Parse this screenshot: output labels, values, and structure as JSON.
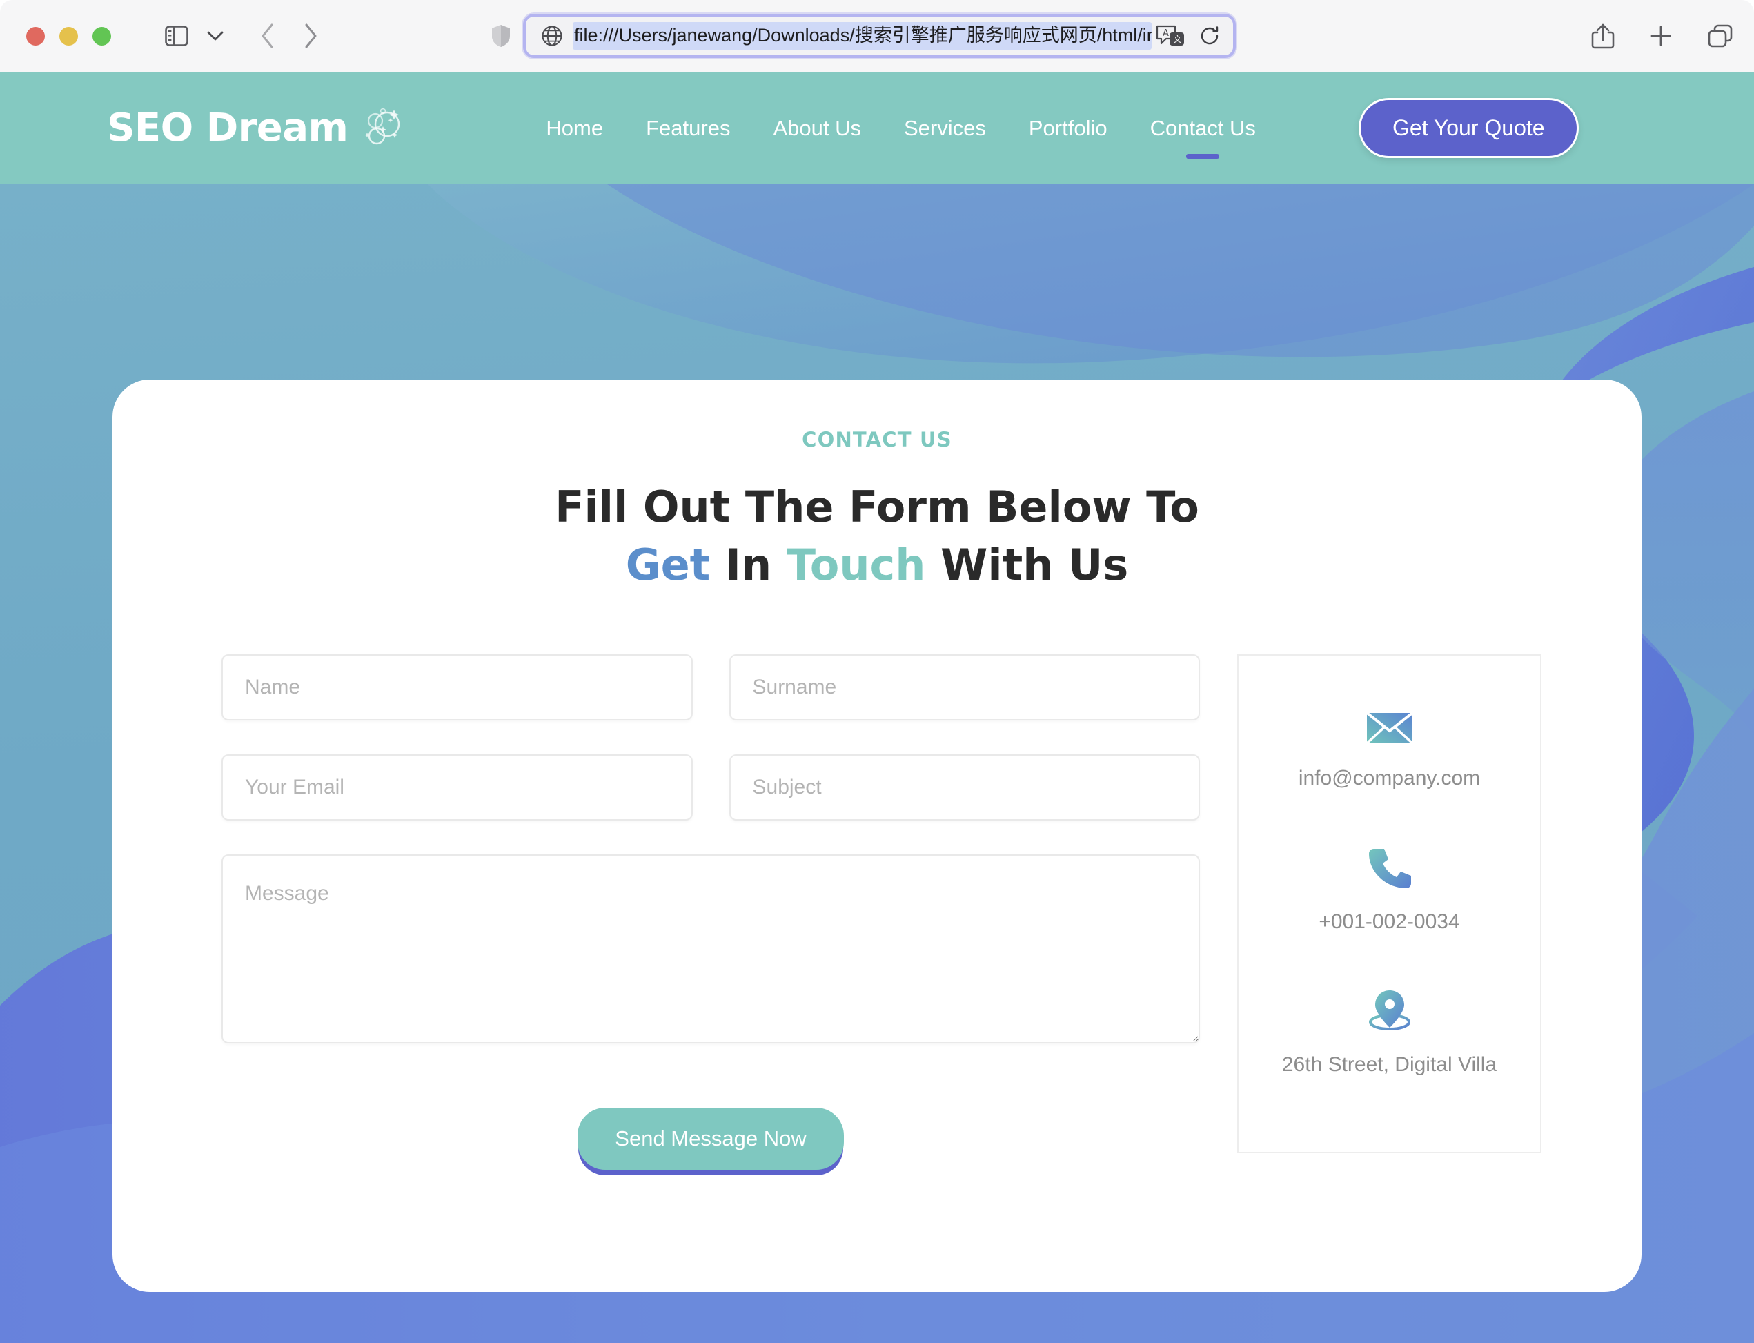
{
  "browser": {
    "url": "file:///Users/janewang/Downloads/搜索引擎推广服务响应式网页/html/inde",
    "traffic_lights": [
      "close",
      "minimize",
      "maximize"
    ],
    "icons": {
      "sidebar": "sidebar-icon",
      "chevron": "chevron-down-icon",
      "back": "back-arrow-icon",
      "forward": "forward-arrow-icon",
      "shield": "shield-icon",
      "globe": "globe-icon",
      "translate": "translate-icon",
      "reload": "reload-icon",
      "share": "share-icon",
      "new_tab": "plus-icon",
      "tab_overview": "tabs-icon"
    }
  },
  "site": {
    "brand": "SEO Dream",
    "brand_icon": "bubbles-sparkle-icon",
    "nav": [
      {
        "label": "Home",
        "active": false
      },
      {
        "label": "Features",
        "active": false
      },
      {
        "label": "About Us",
        "active": false
      },
      {
        "label": "Services",
        "active": false
      },
      {
        "label": "Portfolio",
        "active": false
      },
      {
        "label": "Contact Us",
        "active": true
      }
    ],
    "cta": "Get Your Quote",
    "colors": {
      "header_teal": "#84c9c1",
      "accent_indigo": "#5c62cb",
      "accent_teal": "#7ec8bf",
      "accent_blue": "#5b8ecb",
      "hero_blue": "#6ea7c4",
      "wave_blue": "#5b76d8"
    }
  },
  "contact": {
    "eyebrow": "CONTACT US",
    "headline_line1": "Fill Out The Form Below To",
    "headline_get": "Get",
    "headline_in": "In",
    "headline_touch": "Touch",
    "headline_with_us": "With Us",
    "form": {
      "name_placeholder": "Name",
      "surname_placeholder": "Surname",
      "email_placeholder": "Your Email",
      "subject_placeholder": "Subject",
      "message_placeholder": "Message",
      "submit_label": "Send Message Now",
      "name_value": "",
      "surname_value": "",
      "email_value": "",
      "subject_value": "",
      "message_value": ""
    },
    "info": [
      {
        "icon": "envelope-icon",
        "text": "info@company.com"
      },
      {
        "icon": "phone-icon",
        "text": "+001-002-0034"
      },
      {
        "icon": "location-pin-icon",
        "text": "26th Street, Digital Villa"
      }
    ]
  }
}
